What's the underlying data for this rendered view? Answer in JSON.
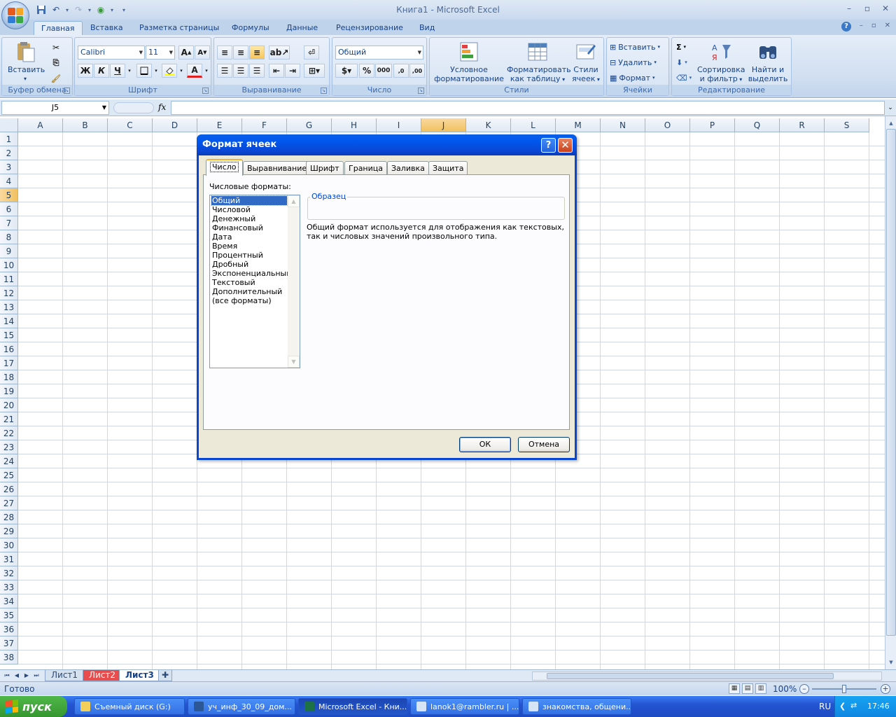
{
  "window": {
    "title": "Книга1 - Microsoft Excel",
    "controls": [
      "minimize-icon",
      "restore-icon",
      "close-icon"
    ]
  },
  "ribbon": {
    "tabs": [
      {
        "label": "Главная",
        "active": true
      },
      {
        "label": "Вставка"
      },
      {
        "label": "Разметка страницы"
      },
      {
        "label": "Формулы"
      },
      {
        "label": "Данные"
      },
      {
        "label": "Рецензирование"
      },
      {
        "label": "Вид"
      }
    ],
    "groups": {
      "clipboard": {
        "label": "Буфер обмена",
        "paste": "Вставить"
      },
      "font": {
        "label": "Шрифт",
        "font_name": "Calibri",
        "font_size": "11",
        "bold": "Ж",
        "italic": "К",
        "underline": "Ч",
        "font_color_letter": "А"
      },
      "alignment": {
        "label": "Выравнивание"
      },
      "number": {
        "label": "Число",
        "format": "Общий"
      },
      "styles": {
        "label": "Стили",
        "cond_line1": "Условное",
        "cond_line2": "форматирование",
        "table_line1": "Форматировать",
        "table_line2": "как таблицу",
        "cell_line1": "Стили",
        "cell_line2": "ячеек"
      },
      "cells": {
        "label": "Ячейки",
        "insert": "Вставить",
        "delete": "Удалить",
        "format": "Формат"
      },
      "editing": {
        "label": "Редактирование",
        "sort_line1": "Сортировка",
        "sort_line2": "и фильтр",
        "find_line1": "Найти и",
        "find_line2": "выделить"
      }
    }
  },
  "formula_bar": {
    "name_box": "J5",
    "fx": "fx",
    "value": ""
  },
  "sheet": {
    "columns": [
      "A",
      "B",
      "C",
      "D",
      "E",
      "F",
      "G",
      "H",
      "I",
      "J",
      "K",
      "L",
      "M",
      "N",
      "O",
      "P",
      "Q",
      "R",
      "S"
    ],
    "rows": [
      "1",
      "2",
      "3",
      "4",
      "5",
      "6",
      "7",
      "8",
      "9",
      "10",
      "11",
      "12",
      "13",
      "14",
      "15",
      "16",
      "17",
      "18",
      "19",
      "20",
      "21",
      "22",
      "23",
      "24",
      "25",
      "26",
      "27",
      "28",
      "29",
      "30",
      "31",
      "32",
      "33",
      "34",
      "35",
      "36",
      "37",
      "38"
    ],
    "selected_cell": "J5",
    "tabs": [
      {
        "label": "Лист1",
        "color": ""
      },
      {
        "label": "Лист2",
        "color": "#e84c4c"
      },
      {
        "label": "Лист3",
        "active": true
      }
    ]
  },
  "status_bar": {
    "text": "Готово",
    "zoom": "100%"
  },
  "dialog": {
    "title": "Формат ячеек",
    "tabs": [
      "Число",
      "Выравнивание",
      "Шрифт",
      "Граница",
      "Заливка",
      "Защита"
    ],
    "active_tab": "Число",
    "formats_label": "Числовые форматы:",
    "formats": [
      "Общий",
      "Числовой",
      "Денежный",
      "Финансовый",
      "Дата",
      "Время",
      "Процентный",
      "Дробный",
      "Экспоненциальный",
      "Текстовый",
      "Дополнительный",
      "(все форматы)"
    ],
    "selected_format": "Общий",
    "sample_label": "Образец",
    "description": "Общий формат используется для отображения как текстовых, так и числовых значений произвольного типа.",
    "ok": "ОК",
    "cancel": "Отмена"
  },
  "taskbar": {
    "start": "пуск",
    "tasks": [
      {
        "label": "Съемный диск (G:)",
        "icon": "folder-icon"
      },
      {
        "label": "уч_инф_30_09_дом...",
        "icon": "word-icon"
      },
      {
        "label": "Microsoft Excel - Кни...",
        "icon": "excel-icon",
        "active": true
      },
      {
        "label": "lanok1@rambler.ru | ...",
        "icon": "mail-icon"
      },
      {
        "label": "знакомства, общени...",
        "icon": "browser-icon"
      }
    ],
    "lang": "RU",
    "clock": "17:46"
  }
}
